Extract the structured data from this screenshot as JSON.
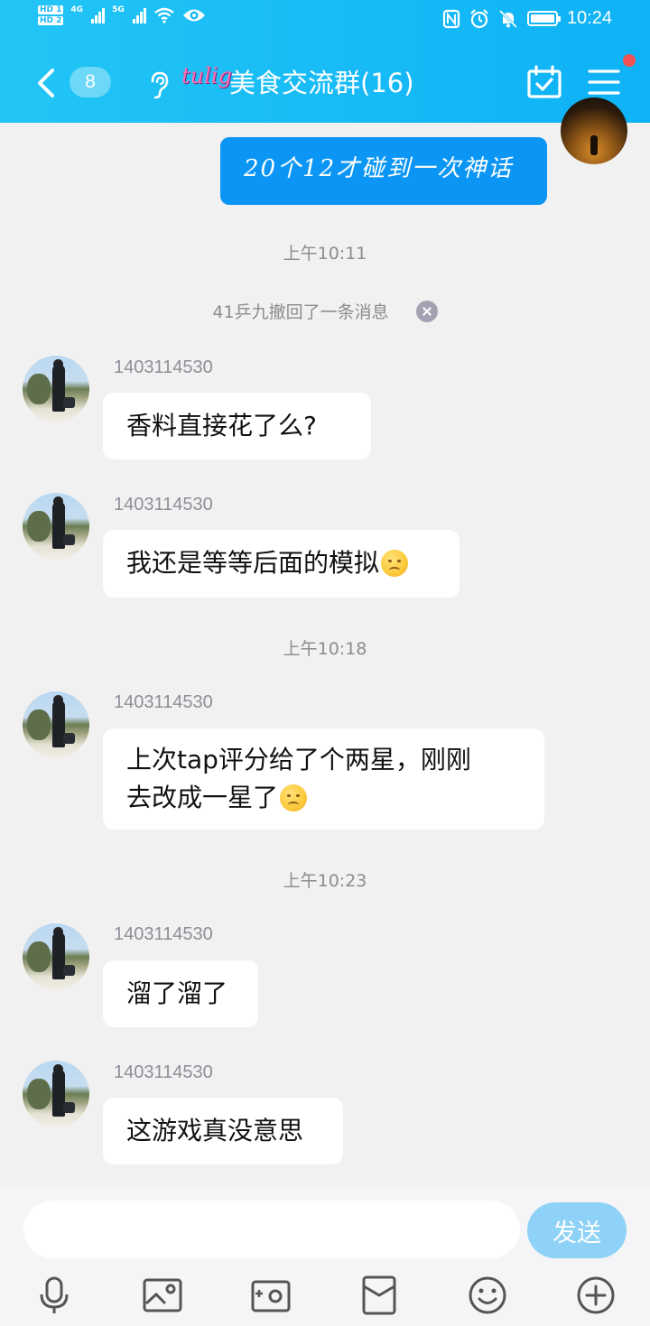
{
  "status_bar": {
    "hd1": "HD 1",
    "hd2": "HD 2",
    "sig1_label": "4G",
    "sig2_label": "5G",
    "time": "10:24"
  },
  "header": {
    "unread_count": "8",
    "logo_text": "tulig",
    "title": "美食交流群(16)",
    "colors": {
      "gradient_start": "#22c5f5",
      "gradient_end": "#0eb2f6",
      "notification_dot": "#f05252"
    }
  },
  "messages": {
    "my_message": "20个12才碰到一次神话",
    "time_1": "上午10:11",
    "recall_notice": "41乒九撤回了一条消息",
    "items": [
      {
        "sender": "1403114530",
        "text": "香料直接花了么?"
      },
      {
        "sender": "1403114530",
        "text": "我还是等等后面的模拟"
      },
      {
        "sender": "1403114530",
        "text_line1": "上次tap评分给了个两星，刚刚",
        "text_line2": "去改成一星了"
      },
      {
        "sender": "1403114530",
        "text": "溜了溜了"
      },
      {
        "sender": "1403114530",
        "text": "这游戏真没意思"
      }
    ],
    "time_2": "上午10:18",
    "time_3": "上午10:23"
  },
  "input": {
    "placeholder": "",
    "send_label": "发送",
    "colors": {
      "send_button": "#8fd2f7",
      "my_bubble": "#0b96f5"
    }
  },
  "toolbar_icons": [
    "microphone-icon",
    "image-icon",
    "camera-icon",
    "red-packet-icon",
    "emoji-icon",
    "plus-icon"
  ]
}
